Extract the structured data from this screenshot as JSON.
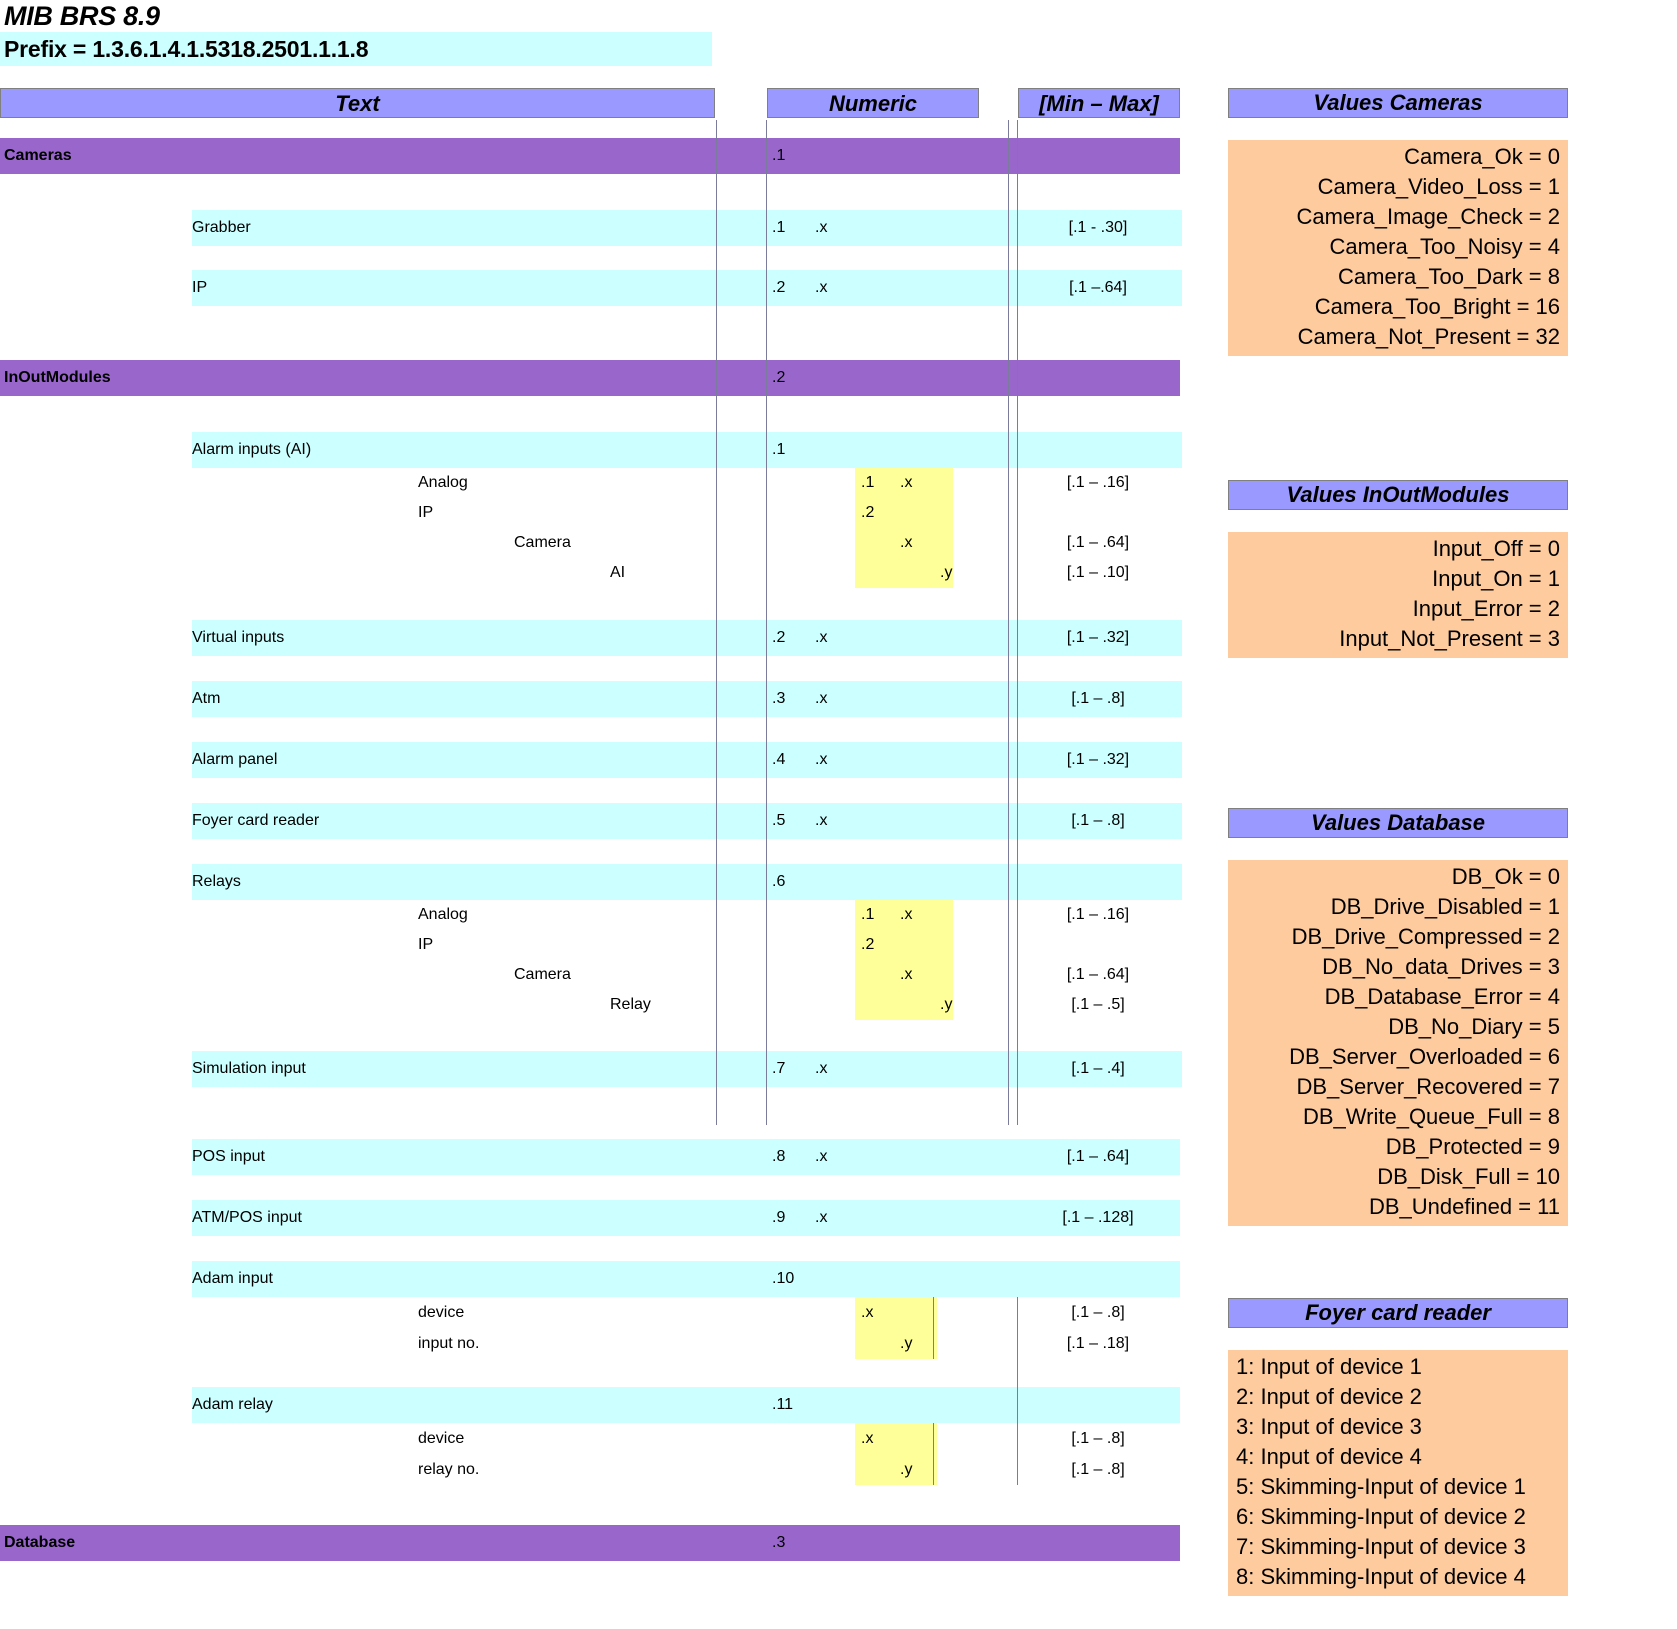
{
  "document": {
    "title": "MIB BRS 8.9",
    "prefix": "Prefix = 1.3.6.1.4.1.5318.2501.1.1.8"
  },
  "colors": {
    "header_blue": "#9999ff",
    "group_purple": "#9966cc",
    "row_cyan": "#ccffff",
    "panel_orange": "#fdcb9e",
    "highlight_yellow": "#ffff99"
  },
  "table": {
    "headers": {
      "text": "Text",
      "numeric": "Numeric",
      "minmax": "[Min – Max]"
    },
    "rows": [
      {
        "kind": "group",
        "level": 0,
        "text": "Cameras",
        "n_a": ".1",
        "n_b": "",
        "n_c": "",
        "n_d": "",
        "minmax": ""
      },
      {
        "kind": "item",
        "level": 1,
        "text": "Grabber",
        "n_a": ".1",
        "n_b": ".x",
        "n_c": "",
        "n_d": "",
        "minmax": "[.1 - .30]"
      },
      {
        "kind": "item",
        "level": 1,
        "text": "IP",
        "n_a": ".2",
        "n_b": ".x",
        "n_c": "",
        "n_d": "",
        "minmax": "[.1 –.64]"
      },
      {
        "kind": "group",
        "level": 0,
        "text": "InOutModules",
        "n_a": ".2",
        "n_b": "",
        "n_c": "",
        "n_d": "",
        "minmax": ""
      },
      {
        "kind": "item",
        "level": 1,
        "text": "Alarm inputs (AI)",
        "n_a": ".1",
        "n_b": "",
        "n_c": "",
        "n_d": "",
        "minmax": ""
      },
      {
        "kind": "sub",
        "level": 2,
        "text": "Analog",
        "n_a": "",
        "n_b": "",
        "n_c": ".1",
        "n_d": ".x",
        "minmax": "[.1 – .16]"
      },
      {
        "kind": "sub",
        "level": 2,
        "text": "IP",
        "n_a": "",
        "n_b": "",
        "n_c": ".2",
        "n_d": "",
        "minmax": ""
      },
      {
        "kind": "sub",
        "level": 3,
        "text": "Camera",
        "n_a": "",
        "n_b": "",
        "n_c": "",
        "n_d": ".x",
        "minmax": "[.1 – .64]"
      },
      {
        "kind": "sub",
        "level": 4,
        "text": "AI",
        "n_a": "",
        "n_b": "",
        "n_c": "",
        "n_e": ".y",
        "minmax": "[.1 – .10]"
      },
      {
        "kind": "item",
        "level": 1,
        "text": "Virtual inputs",
        "n_a": ".2",
        "n_b": ".x",
        "n_c": "",
        "n_d": "",
        "minmax": "[.1 – .32]"
      },
      {
        "kind": "item",
        "level": 1,
        "text": "Atm",
        "n_a": ".3",
        "n_b": ".x",
        "n_c": "",
        "n_d": "",
        "minmax": "[.1 – .8]"
      },
      {
        "kind": "item",
        "level": 1,
        "text": "Alarm panel",
        "n_a": ".4",
        "n_b": ".x",
        "n_c": "",
        "n_d": "",
        "minmax": "[.1 – .32]"
      },
      {
        "kind": "item",
        "level": 1,
        "text": "Foyer card reader",
        "n_a": ".5",
        "n_b": ".x",
        "n_c": "",
        "n_d": "",
        "minmax": "[.1 – .8]"
      },
      {
        "kind": "item",
        "level": 1,
        "text": "Relays",
        "n_a": ".6",
        "n_b": "",
        "n_c": "",
        "n_d": "",
        "minmax": ""
      },
      {
        "kind": "sub",
        "level": 2,
        "text": "Analog",
        "n_a": "",
        "n_b": "",
        "n_c": ".1",
        "n_d": ".x",
        "minmax": "[.1 – .16]"
      },
      {
        "kind": "sub",
        "level": 2,
        "text": "IP",
        "n_a": "",
        "n_b": "",
        "n_c": ".2",
        "n_d": "",
        "minmax": ""
      },
      {
        "kind": "sub",
        "level": 3,
        "text": "Camera",
        "n_a": "",
        "n_b": "",
        "n_c": "",
        "n_d": ".x",
        "minmax": "[.1 – .64]"
      },
      {
        "kind": "sub",
        "level": 4,
        "text": "Relay",
        "n_a": "",
        "n_b": "",
        "n_c": "",
        "n_e": ".y",
        "minmax": "[.1 – .5]"
      },
      {
        "kind": "item",
        "level": 1,
        "text": "Simulation input",
        "n_a": ".7",
        "n_b": ".x",
        "n_c": "",
        "n_d": "",
        "minmax": "[.1 – .4]"
      },
      {
        "kind": "item",
        "level": 1,
        "text": "POS input",
        "n_a": ".8",
        "n_b": ".x",
        "n_c": "",
        "n_d": "",
        "minmax": "[.1 – .64]"
      },
      {
        "kind": "item",
        "level": 1,
        "text": "ATM/POS input",
        "n_a": ".9",
        "n_b": ".x",
        "n_c": "",
        "n_d": "",
        "minmax": "[.1 – .128]"
      },
      {
        "kind": "item",
        "level": 1,
        "text": "Adam input",
        "n_a": ".10",
        "n_b": "",
        "n_c": "",
        "n_d": "",
        "minmax": ""
      },
      {
        "kind": "sub",
        "level": 2,
        "text": "device",
        "n_a": "",
        "n_b": "",
        "n_c": ".x",
        "n_d": "",
        "minmax": "[.1 – .8]"
      },
      {
        "kind": "sub",
        "level": 2,
        "text": "input no.",
        "n_a": "",
        "n_b": "",
        "n_c": "",
        "n_d": ".y",
        "minmax": "[.1 – .18]"
      },
      {
        "kind": "item",
        "level": 1,
        "text": "Adam relay",
        "n_a": ".11",
        "n_b": "",
        "n_c": "",
        "n_d": "",
        "minmax": ""
      },
      {
        "kind": "sub",
        "level": 2,
        "text": "device",
        "n_a": "",
        "n_b": "",
        "n_c": ".x",
        "n_d": "",
        "minmax": "[.1 – .8]"
      },
      {
        "kind": "sub",
        "level": 2,
        "text": "relay no.",
        "n_a": "",
        "n_b": "",
        "n_c": "",
        "n_d": ".y",
        "minmax": "[.1 – .8]"
      },
      {
        "kind": "group",
        "level": 0,
        "text": "Database",
        "n_a": ".3",
        "n_b": "",
        "n_c": "",
        "n_d": "",
        "minmax": ""
      }
    ]
  },
  "sidebar": {
    "panels": [
      {
        "title": "Values Cameras",
        "align": "right",
        "lines": [
          "Camera_Ok = 0",
          "Camera_Video_Loss = 1",
          "Camera_Image_Check = 2",
          "Camera_Too_Noisy = 4",
          "Camera_Too_Dark = 8",
          "Camera_Too_Bright = 16",
          "Camera_Not_Present = 32"
        ]
      },
      {
        "title": "Values InOutModules",
        "align": "right",
        "lines": [
          "Input_Off = 0",
          "Input_On = 1",
          "Input_Error = 2",
          "Input_Not_Present = 3"
        ]
      },
      {
        "title": "Values Database",
        "align": "right",
        "lines": [
          "DB_Ok = 0",
          "DB_Drive_Disabled = 1",
          "DB_Drive_Compressed = 2",
          "DB_No_data_Drives = 3",
          "DB_Database_Error = 4",
          "DB_No_Diary = 5",
          "DB_Server_Overloaded = 6",
          "DB_Server_Recovered = 7",
          "DB_Write_Queue_Full = 8",
          "DB_Protected = 9",
          "DB_Disk_Full = 10",
          "DB_Undefined = 11"
        ]
      },
      {
        "title": "Foyer card reader",
        "align": "left",
        "lines": [
          "1: Input of device 1",
          "2: Input of device 2",
          "3: Input of device 3",
          "4: Input of device 4",
          "5: Skimming-Input of device 1",
          "6: Skimming-Input of device 2",
          "7: Skimming-Input of device 3",
          "8: Skimming-Input of device 4"
        ]
      }
    ]
  }
}
